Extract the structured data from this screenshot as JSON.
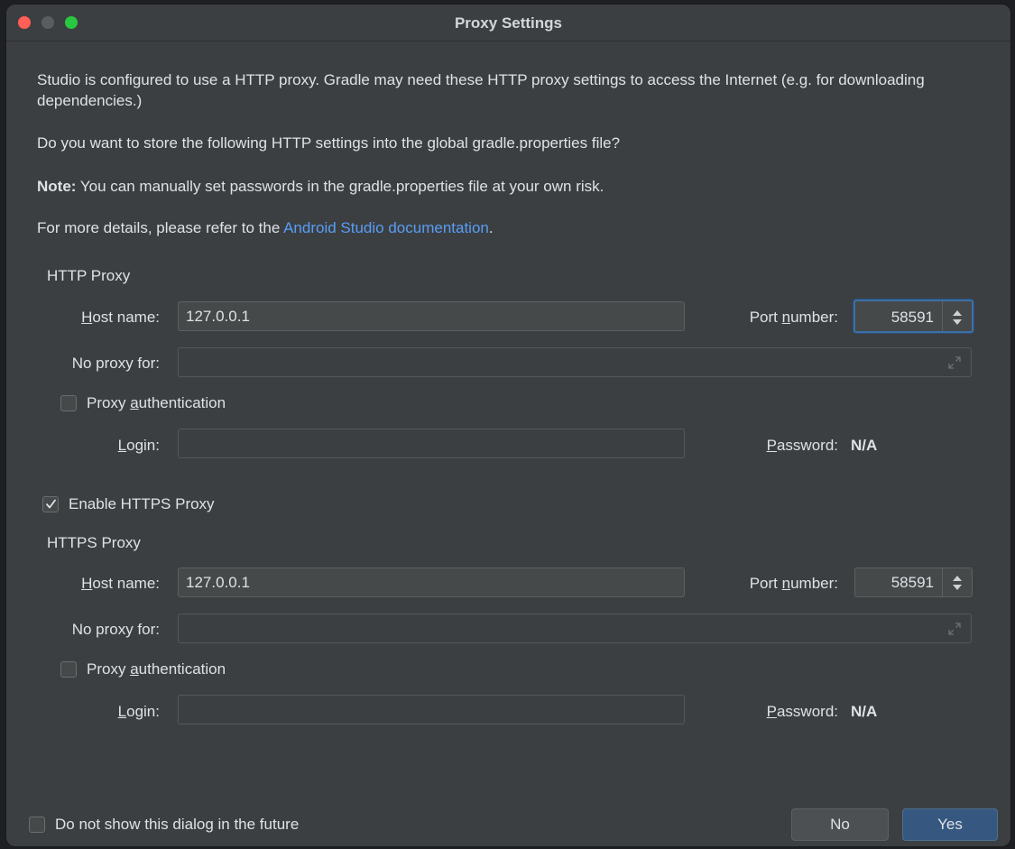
{
  "window": {
    "title": "Proxy Settings"
  },
  "intro": {
    "line1": "Studio is configured to use a HTTP proxy. Gradle may need these HTTP proxy settings to access the Internet (e.g. for downloading dependencies.)",
    "line2": "Do you want to store the following HTTP settings into the global gradle.properties file?",
    "note_label": "Note:",
    "note_text": " You can manually set passwords in the gradle.properties file at your own risk.",
    "details_prefix": "For more details, please refer to the ",
    "details_link": "Android Studio documentation",
    "details_suffix": "."
  },
  "http": {
    "section": "HTTP Proxy",
    "host_label_u": "H",
    "host_label_rest": "ost name:",
    "host_value": "127.0.0.1",
    "port_label_pre": "Port ",
    "port_label_u": "n",
    "port_label_rest": "umber:",
    "port_value": "58591",
    "noproxy_label": "No proxy for:",
    "noproxy_value": "",
    "auth_pre": "Proxy ",
    "auth_u": "a",
    "auth_rest": "uthentication",
    "auth_checked": false,
    "login_u": "L",
    "login_rest": "ogin:",
    "login_value": "",
    "password_u": "P",
    "password_rest": "assword:",
    "password_value": "N/A"
  },
  "https_toggle": {
    "label": "Enable HTTPS Proxy",
    "checked": true
  },
  "https": {
    "section": "HTTPS Proxy",
    "host_label_u": "H",
    "host_label_rest": "ost name:",
    "host_value": "127.0.0.1",
    "port_label_pre": "Port ",
    "port_label_u": "n",
    "port_label_rest": "umber:",
    "port_value": "58591",
    "noproxy_label": "No proxy for:",
    "noproxy_value": "",
    "auth_pre": "Proxy ",
    "auth_u": "a",
    "auth_rest": "uthentication",
    "auth_checked": false,
    "login_u": "L",
    "login_rest": "ogin:",
    "login_value": "",
    "password_u": "P",
    "password_rest": "assword:",
    "password_value": "N/A"
  },
  "footer": {
    "dont_show_label": "Do not show this dialog in the future",
    "no_label": "No",
    "yes_label": "Yes"
  },
  "colors": {
    "link": "#589df6",
    "primary_button": "#365880",
    "focus_ring": "#3d6fa5"
  }
}
